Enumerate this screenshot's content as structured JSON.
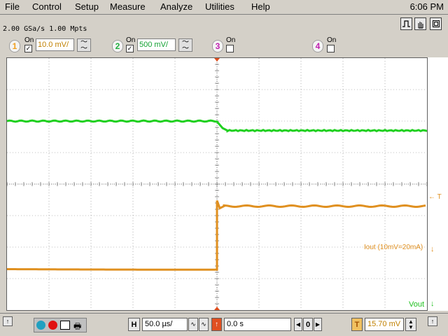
{
  "menu": {
    "items": [
      "File",
      "Control",
      "Setup",
      "Measure",
      "Analyze",
      "Utilities",
      "Help"
    ],
    "clock": "6:06 PM"
  },
  "acquisition": {
    "rate_text": "2.00 GSa/s   1.00 Mpts"
  },
  "channels": [
    {
      "number": "1",
      "on_label": "On",
      "checked": true,
      "scale": "10.0 mV/",
      "color": "#f0a020"
    },
    {
      "number": "2",
      "on_label": "On",
      "checked": true,
      "scale": "500 mV/",
      "color": "#20b040"
    },
    {
      "number": "3",
      "on_label": "On",
      "checked": false,
      "scale": "",
      "color": "#d030c0"
    },
    {
      "number": "4",
      "on_label": "On",
      "checked": false,
      "scale": "",
      "color": "#d030c0"
    }
  ],
  "display": {
    "grid_color": "#808080",
    "vout_color": "#20d020",
    "iout_color": "#e09020",
    "trigger_marker": "← T",
    "iout_label": "Iout (10mV=20mA)",
    "vout_label": "Vout",
    "trace_levels": {
      "vout_before_div": 2.0,
      "vout_after_div": 2.3,
      "iout_before_div": 6.7,
      "iout_after_div": 4.7,
      "edge_div": 5.0
    }
  },
  "bottom": {
    "horizontal_label": "H",
    "timebase": "50.0 µs/",
    "delay": "0.0 s",
    "delay_button": "0",
    "trigger_label": "T",
    "trigger_level": "15.70 mV"
  }
}
